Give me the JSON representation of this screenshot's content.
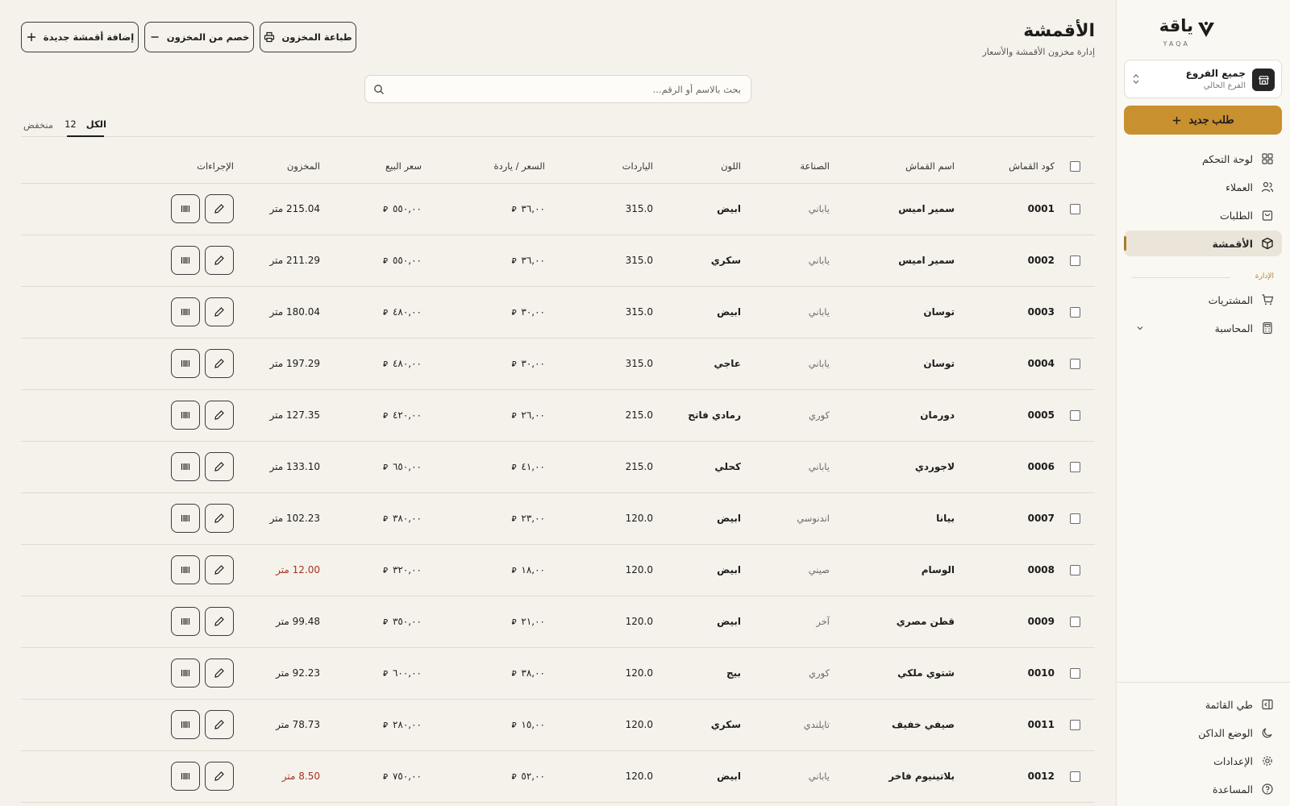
{
  "brand": {
    "name": "ياقة",
    "sub": "YAQA"
  },
  "branch": {
    "title": "جميع الفروع",
    "subtitle": "الفرع الحالي"
  },
  "sidebar": {
    "new_order": "طلب جديد",
    "items": [
      {
        "label": "لوحة التحكم",
        "icon": "dashboard-icon"
      },
      {
        "label": "العملاء",
        "icon": "users-icon"
      },
      {
        "label": "الطلبات",
        "icon": "bag-icon"
      },
      {
        "label": "الأقمشة",
        "icon": "box-icon",
        "active": true
      }
    ],
    "section_label": "الإدارة",
    "admin_items": [
      {
        "label": "المشتريات",
        "icon": "cart-icon"
      },
      {
        "label": "المحاسبة",
        "icon": "calculator-icon"
      }
    ],
    "footer_items": [
      {
        "label": "طي القائمة",
        "icon": "collapse-sidebar-icon"
      },
      {
        "label": "الوضع الداكن",
        "icon": "moon-icon"
      },
      {
        "label": "الإعدادات",
        "icon": "gear-icon"
      },
      {
        "label": "المساعدة",
        "icon": "help-icon"
      }
    ]
  },
  "header": {
    "title": "الأقمشة",
    "subtitle": "إدارة مخزون الأقمشة والأسعار",
    "print_label": "طباعة المخزون",
    "deduct_label": "خصم من المخزون",
    "add_label": "إضافة أقمشة جديدة"
  },
  "search": {
    "placeholder": "بحث بالاسم أو الرقم..."
  },
  "tabs": {
    "all_label": "الكل",
    "all_count": "12",
    "low_label": "منخفض"
  },
  "table": {
    "columns": [
      "كود القماش",
      "اسم القماش",
      "الصناعة",
      "اللون",
      "الياردات",
      "السعر / ياردة",
      "سعر البيع",
      "المخزون",
      "الإجراءات"
    ],
    "currency_symbol": "⃁",
    "rows": [
      {
        "code": "0001",
        "name": "سمير اميس",
        "origin": "ياباني",
        "color": "ابيض",
        "yards": "315.0",
        "price": "٣٦,٠٠",
        "sale": "٥٥٠,٠٠",
        "stock": "215.04 متر",
        "low": false
      },
      {
        "code": "0002",
        "name": "سمير اميس",
        "origin": "ياباني",
        "color": "سكري",
        "yards": "315.0",
        "price": "٣٦,٠٠",
        "sale": "٥٥٠,٠٠",
        "stock": "211.29 متر",
        "low": false
      },
      {
        "code": "0003",
        "name": "توسان",
        "origin": "ياباني",
        "color": "ابيض",
        "yards": "315.0",
        "price": "٣٠,٠٠",
        "sale": "٤٨٠,٠٠",
        "stock": "180.04 متر",
        "low": false
      },
      {
        "code": "0004",
        "name": "توسان",
        "origin": "ياباني",
        "color": "عاجي",
        "yards": "315.0",
        "price": "٣٠,٠٠",
        "sale": "٤٨٠,٠٠",
        "stock": "197.29 متر",
        "low": false
      },
      {
        "code": "0005",
        "name": "دورمان",
        "origin": "كوري",
        "color": "رمادي فاتح",
        "yards": "215.0",
        "price": "٢٦,٠٠",
        "sale": "٤٢٠,٠٠",
        "stock": "127.35 متر",
        "low": false
      },
      {
        "code": "0006",
        "name": "لاجوردي",
        "origin": "ياباني",
        "color": "كحلي",
        "yards": "215.0",
        "price": "٤١,٠٠",
        "sale": "٦٥٠,٠٠",
        "stock": "133.10 متر",
        "low": false
      },
      {
        "code": "0007",
        "name": "بيانا",
        "origin": "اندنوسي",
        "color": "ابيض",
        "yards": "120.0",
        "price": "٢٣,٠٠",
        "sale": "٣٨٠,٠٠",
        "stock": "102.23 متر",
        "low": false
      },
      {
        "code": "0008",
        "name": "الوسام",
        "origin": "صيني",
        "color": "ابيض",
        "yards": "120.0",
        "price": "١٨,٠٠",
        "sale": "٣٢٠,٠٠",
        "stock": "12.00 متر",
        "low": true
      },
      {
        "code": "0009",
        "name": "قطن مصري",
        "origin": "آخر",
        "color": "ابيض",
        "yards": "120.0",
        "price": "٢١,٠٠",
        "sale": "٣٥٠,٠٠",
        "stock": "99.48 متر",
        "low": false
      },
      {
        "code": "0010",
        "name": "شتوي ملكي",
        "origin": "كوري",
        "color": "بيج",
        "yards": "120.0",
        "price": "٣٨,٠٠",
        "sale": "٦٠٠,٠٠",
        "stock": "92.23 متر",
        "low": false
      },
      {
        "code": "0011",
        "name": "صيفي خفيف",
        "origin": "تايلندي",
        "color": "سكري",
        "yards": "120.0",
        "price": "١٥,٠٠",
        "sale": "٢٨٠,٠٠",
        "stock": "78.73 متر",
        "low": false
      },
      {
        "code": "0012",
        "name": "بلاتينيوم فاخر",
        "origin": "ياباني",
        "color": "ابيض",
        "yards": "120.0",
        "price": "٥٢,٠٠",
        "sale": "٧٥٠,٠٠",
        "stock": "8.50 متر",
        "low": true
      }
    ]
  },
  "colors": {
    "accent": "#c8902e",
    "background": "#f5f2ec",
    "low_stock": "#a8321f",
    "active_nav": "#ebe5d9"
  }
}
